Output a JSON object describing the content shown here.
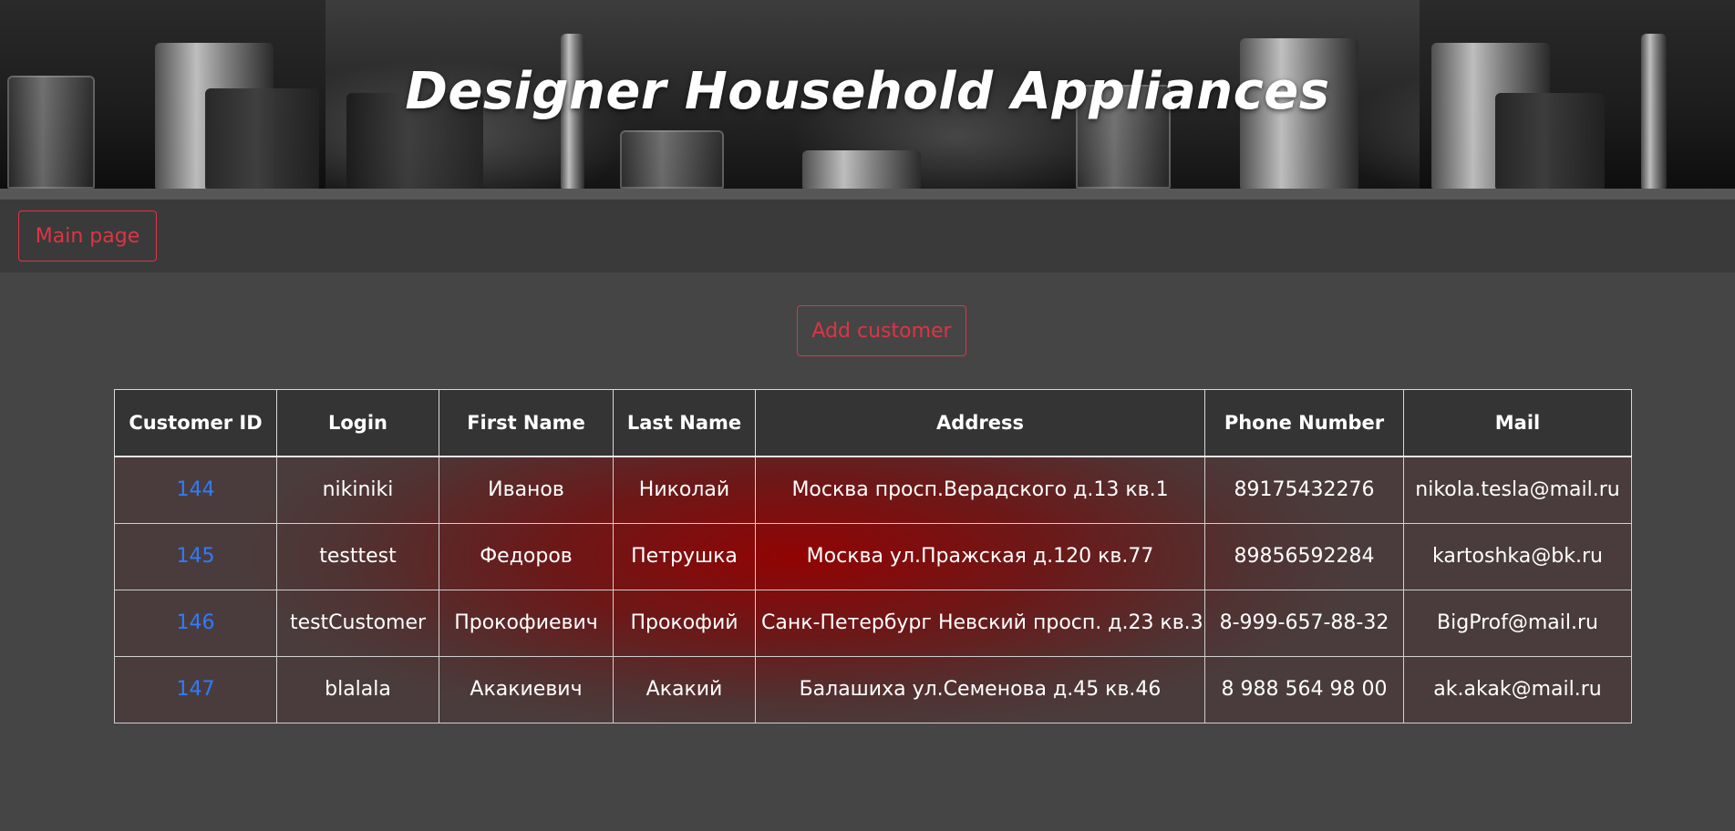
{
  "banner": {
    "title": "Designer Household Appliances"
  },
  "nav": {
    "main_page_label": "Main page"
  },
  "actions": {
    "add_customer_label": "Add customer"
  },
  "table": {
    "headers": {
      "customer_id": "Customer ID",
      "login": "Login",
      "first_name": "First Name",
      "last_name": "Last Name",
      "address": "Address",
      "phone_number": "Phone Number",
      "mail": "Mail"
    },
    "rows": [
      {
        "customer_id": "144",
        "login": "nikiniki",
        "first_name": "Иванов",
        "last_name": "Николай",
        "address": "Москва просп.Верадского д.13 кв.1",
        "phone_number": "89175432276",
        "mail": "nikola.tesla@mail.ru"
      },
      {
        "customer_id": "145",
        "login": "testtest",
        "first_name": "Федоров",
        "last_name": "Петрушка",
        "address": "Москва ул.Пражская д.120 кв.77",
        "phone_number": "89856592284",
        "mail": "kartoshka@bk.ru"
      },
      {
        "customer_id": "146",
        "login": "testCustomer",
        "first_name": "Прокофиевич",
        "last_name": "Прокофий",
        "address": "Санк-Петербург Невский просп. д.23 кв.3",
        "phone_number": "8-999-657-88-32",
        "mail": "BigProf@mail.ru"
      },
      {
        "customer_id": "147",
        "login": "blalala",
        "first_name": "Акакиевич",
        "last_name": "Акакий",
        "address": "Балашиха ул.Семенова д.45 кв.46",
        "phone_number": "8 988 564 98 00",
        "mail": "ak.akak@mail.ru"
      }
    ]
  },
  "colors": {
    "page_background": "#454545",
    "navbar_background": "#3a3a3a",
    "outline_button": "#dc3545",
    "link": "#2f7bff",
    "row_highlight": "#8b0000"
  }
}
